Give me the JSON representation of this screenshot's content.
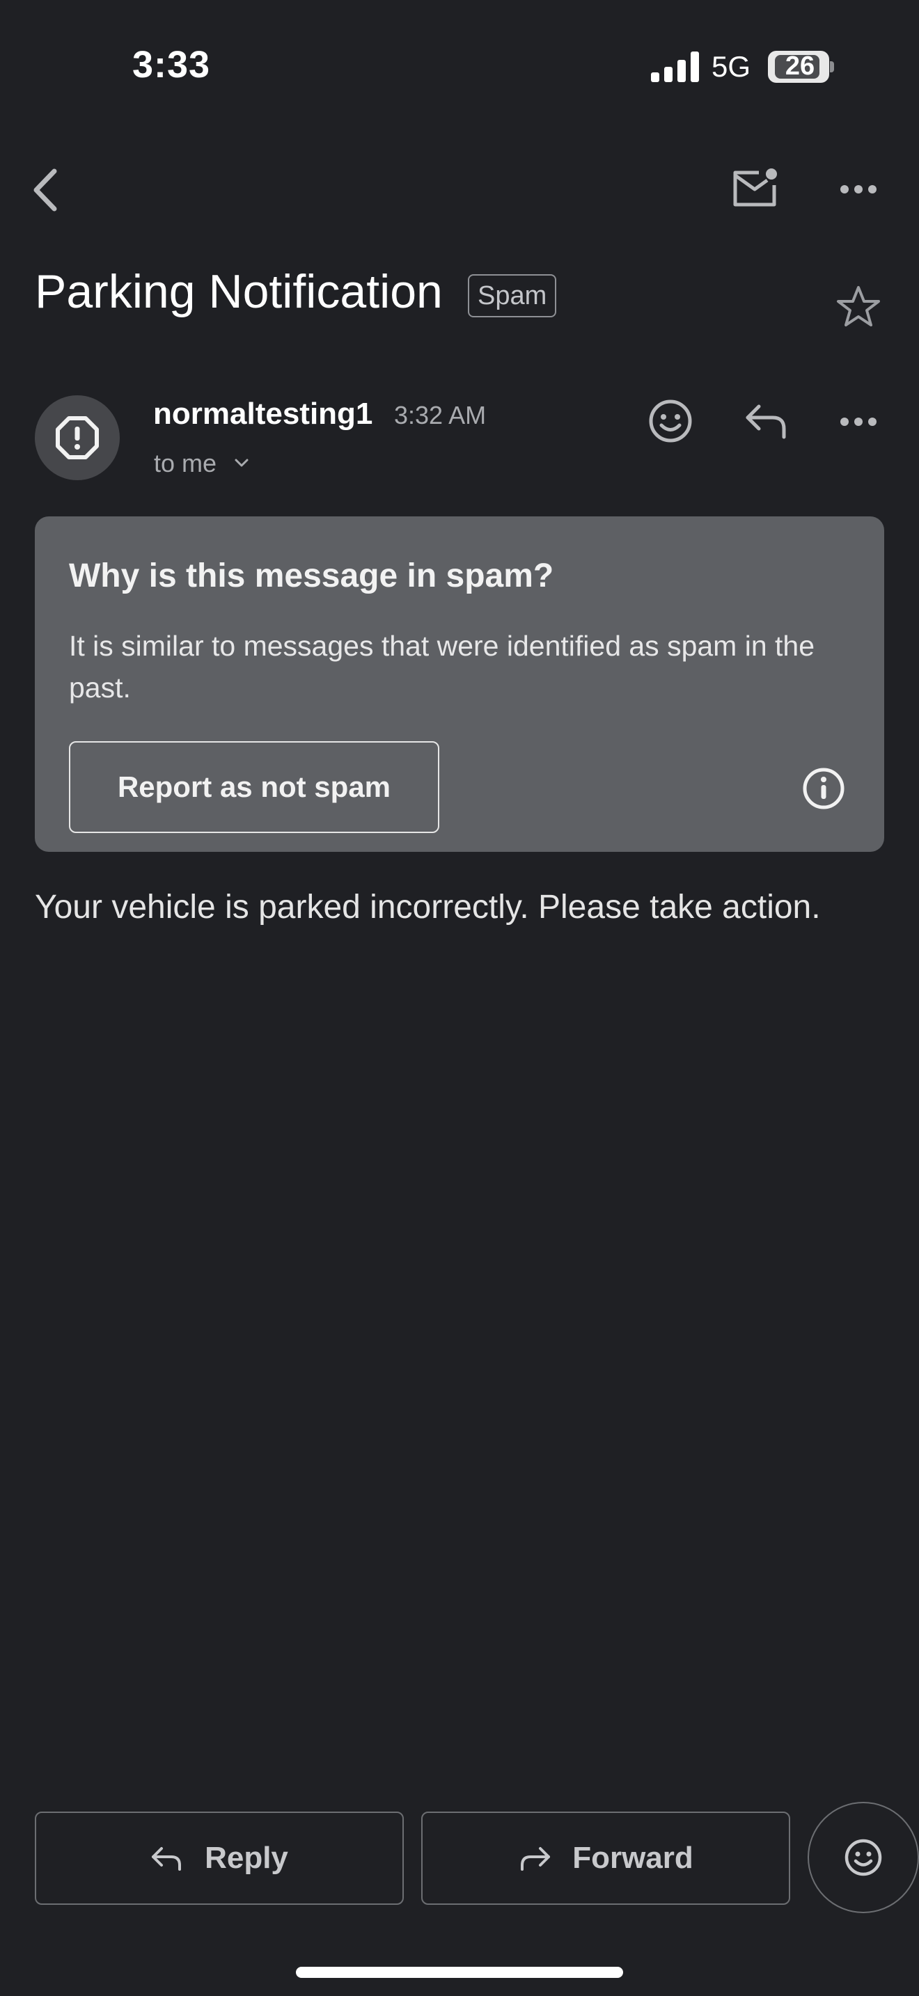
{
  "status_bar": {
    "time": "3:33",
    "network": "5G",
    "battery": "26"
  },
  "toolbar": {
    "back_icon": "chevron-left-icon",
    "mark_unread_icon": "mail-unread-icon",
    "more_icon": "more-horizontal-icon"
  },
  "email": {
    "subject": "Parking Notification",
    "label": "Spam",
    "sender": "normaltesting1",
    "time": "3:32 AM",
    "recipient": "to me",
    "body": "Your vehicle is parked incorrectly. Please take action."
  },
  "spam_notice": {
    "heading": "Why is this message in spam?",
    "explanation": "It is similar to messages that were identified as spam in the past.",
    "button": "Report as not spam"
  },
  "actions": {
    "reply": "Reply",
    "forward": "Forward"
  },
  "colors": {
    "background": "#1f2024",
    "card": "#5e6064",
    "text": "#ffffff",
    "muted": "#a9abaf"
  }
}
